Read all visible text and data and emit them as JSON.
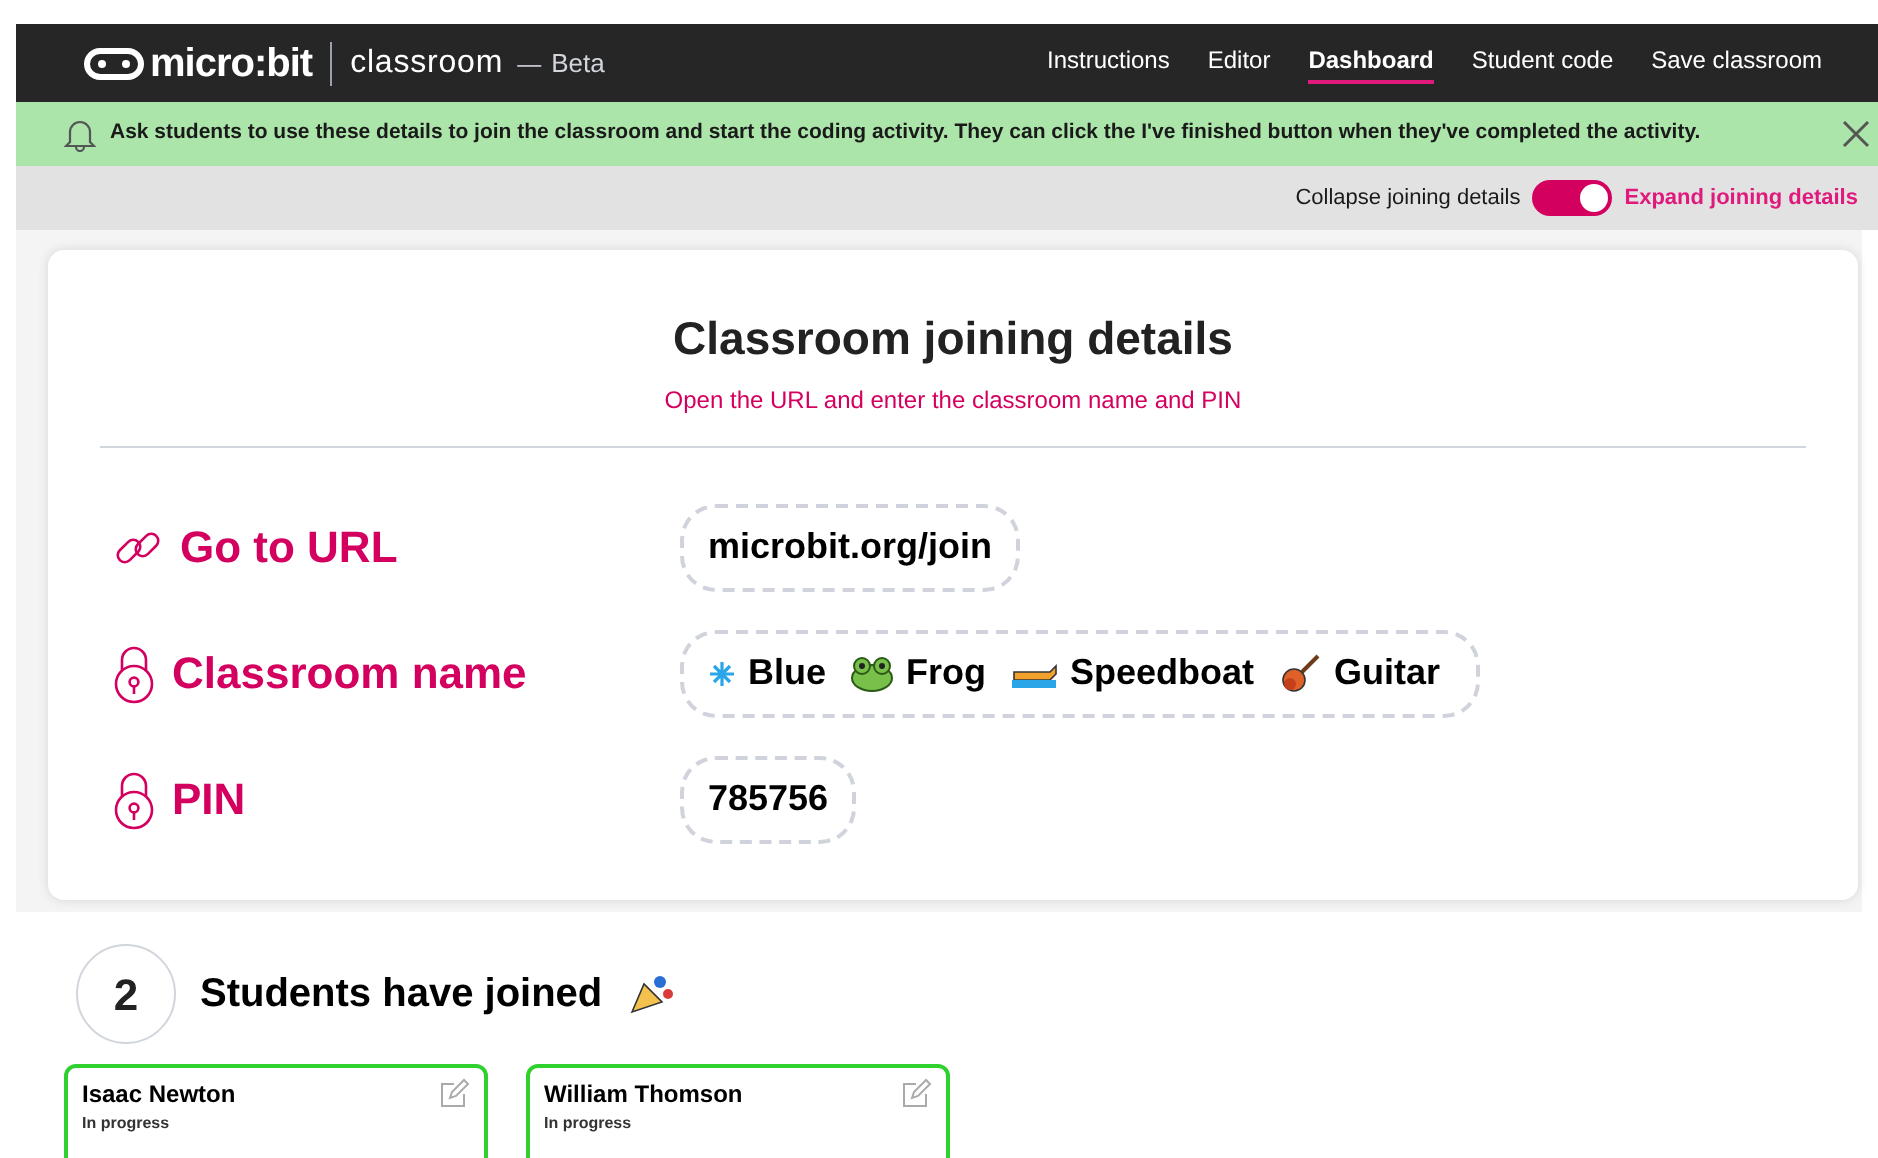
{
  "header": {
    "logo": "micro:bit",
    "product": "classroom",
    "dash": "—",
    "badge": "Beta",
    "nav": [
      {
        "label": "Instructions",
        "selected": false
      },
      {
        "label": "Editor",
        "selected": false
      },
      {
        "label": "Dashboard",
        "selected": true
      },
      {
        "label": "Student code",
        "selected": false
      },
      {
        "label": "Save classroom",
        "selected": false
      }
    ]
  },
  "banner": {
    "text": "Ask students to use these details to join the classroom and start the coding activity. They can click the I've finished button when they've completed the activity."
  },
  "toggle": {
    "off_label": "Collapse joining details",
    "on_label": "Expand joining details",
    "on": true
  },
  "joining": {
    "title": "Classroom joining details",
    "subtitle": "Open the URL and enter the classroom name and PIN",
    "rows": [
      {
        "kind": "url",
        "label": "Go to URL",
        "value": "microbit.org/join"
      },
      {
        "kind": "name",
        "label": "Classroom name",
        "words": [
          "Blue",
          "Frog",
          "Speedboat",
          "Guitar"
        ]
      },
      {
        "kind": "pin",
        "label": "PIN",
        "value": "785756"
      }
    ]
  },
  "students": {
    "count": "2",
    "heading": "Students have joined",
    "cards": [
      {
        "name": "Isaac Newton",
        "status": "In progress"
      },
      {
        "name": "William Thomson",
        "status": "In progress"
      }
    ]
  }
}
